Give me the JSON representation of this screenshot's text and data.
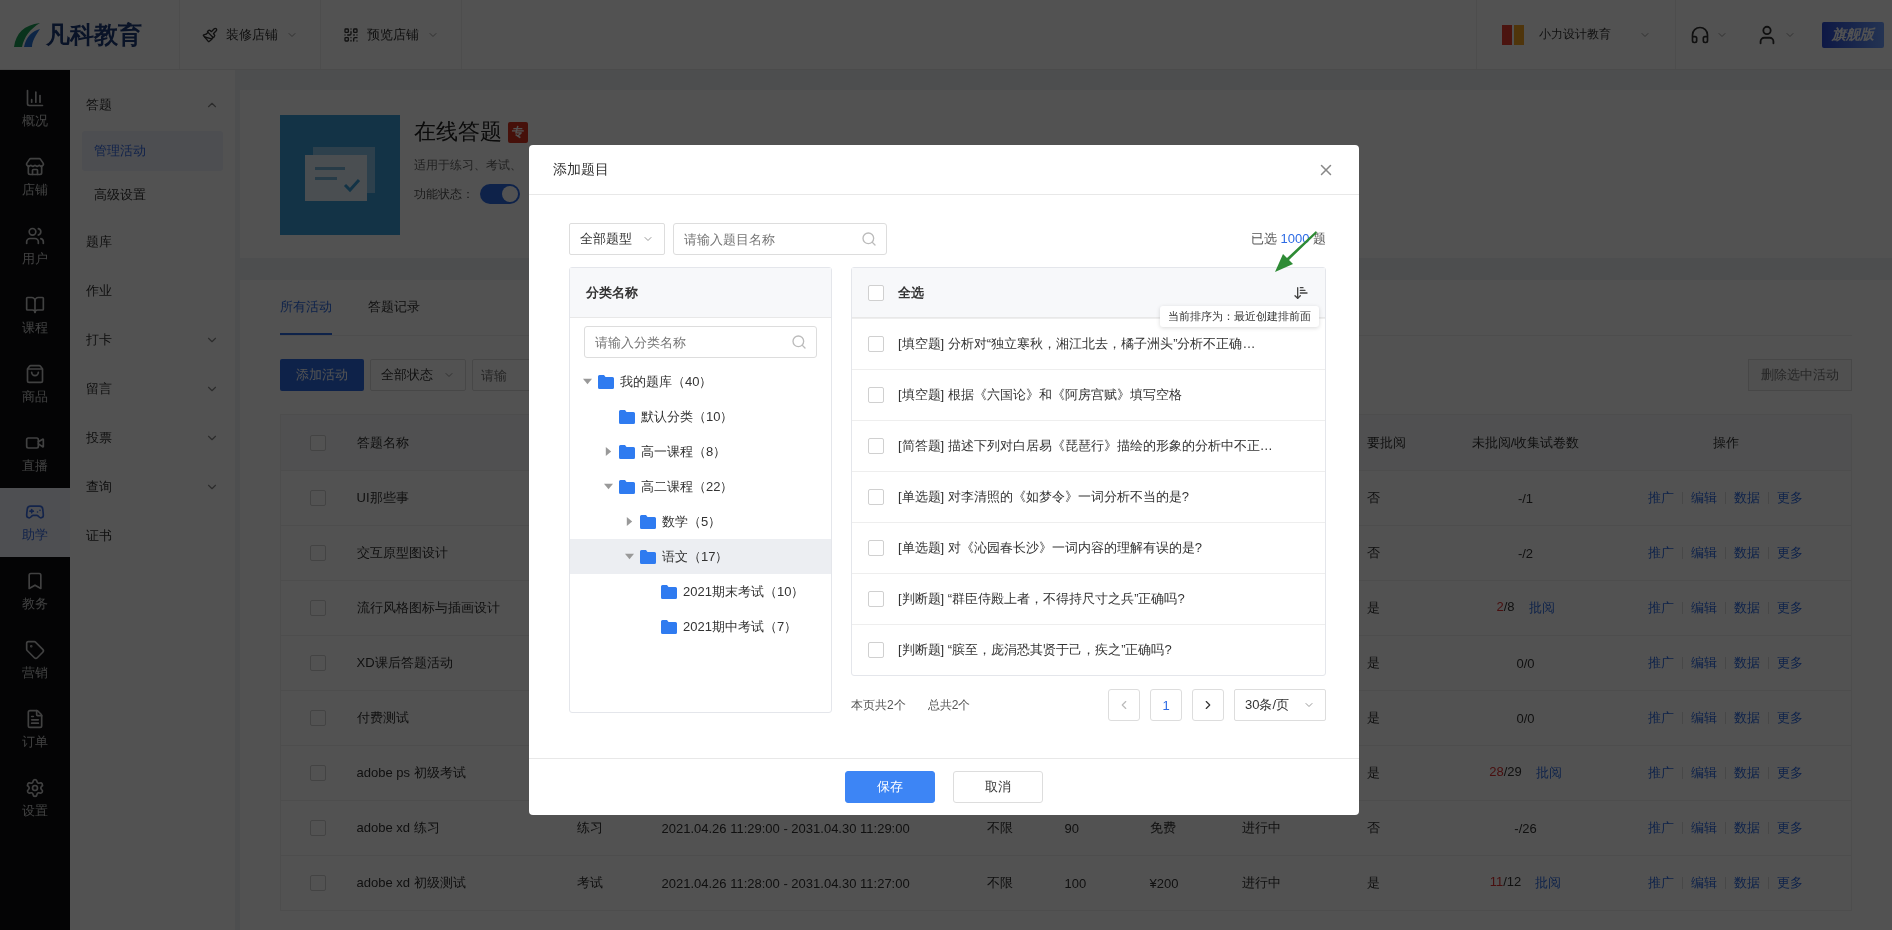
{
  "topbar": {
    "logo": "凡科教育",
    "menus": [
      {
        "label": "装修店铺"
      },
      {
        "label": "预览店铺"
      }
    ],
    "shop": "小力设计教育",
    "edition": "旗舰版"
  },
  "nav": [
    {
      "label": "概况",
      "selected": false
    },
    {
      "label": "店铺",
      "selected": false
    },
    {
      "label": "用户",
      "selected": false
    },
    {
      "label": "课程",
      "selected": false
    },
    {
      "label": "商品",
      "selected": false
    },
    {
      "label": "直播",
      "selected": false
    },
    {
      "label": "助学",
      "selected": true
    },
    {
      "label": "教务",
      "selected": false
    },
    {
      "label": "营销",
      "selected": false
    },
    {
      "label": "订单",
      "selected": false
    },
    {
      "label": "设置",
      "selected": false
    }
  ],
  "subnav": [
    {
      "label": "答题",
      "expanded": true,
      "children": [
        {
          "label": "管理活动",
          "selected": true
        },
        {
          "label": "高级设置",
          "selected": false
        }
      ]
    },
    {
      "label": "题库"
    },
    {
      "label": "作业"
    },
    {
      "label": "打卡",
      "expanded": false
    },
    {
      "label": "留言",
      "expanded": false
    },
    {
      "label": "投票",
      "expanded": false
    },
    {
      "label": "查询",
      "expanded": false
    },
    {
      "label": "证书"
    }
  ],
  "header": {
    "title": "在线答题",
    "tag": "专",
    "description": "适用于练习、考试、",
    "status_label": "功能状态：",
    "enabled": true
  },
  "tabs": [
    {
      "label": "所有活动",
      "selected": true
    },
    {
      "label": "答题记录",
      "selected": false
    }
  ],
  "toolbar": {
    "add_button": "添加活动",
    "status_filter": "全部状态",
    "search_placeholder": "请输",
    "delete_button": "删除选中活动",
    "delete_disabled": true
  },
  "table": {
    "all_checked": false,
    "columns": {
      "name": "答题名称",
      "review": "要批阅",
      "count": "未批阅/收集试卷数",
      "actions": "操作"
    },
    "rows": [
      {
        "checked": false,
        "name": "UI那些事",
        "review": "否",
        "pending": "-",
        "total": "/1",
        "alert": false,
        "actions": [
          "推广",
          "编辑",
          "数据",
          "更多"
        ]
      },
      {
        "checked": false,
        "name": "交互原型图设计",
        "review": "否",
        "pending": "-",
        "total": "/2",
        "alert": false,
        "actions": [
          "推广",
          "编辑",
          "数据",
          "更多"
        ]
      },
      {
        "checked": false,
        "name": "流行风格图标与插画设计",
        "review": "是",
        "pending": "2",
        "total": "/8",
        "alert": true,
        "link": "批阅",
        "actions": [
          "推广",
          "编辑",
          "数据",
          "更多"
        ]
      },
      {
        "checked": false,
        "name": "XD课后答题活动",
        "review": "是",
        "pending": "0",
        "total": "/0",
        "alert": false,
        "actions": [
          "推广",
          "编辑",
          "数据",
          "更多"
        ]
      },
      {
        "checked": false,
        "name": "付费测试",
        "review": "是",
        "pending": "0",
        "total": "/0",
        "alert": false,
        "actions": [
          "推广",
          "编辑",
          "数据",
          "更多"
        ]
      },
      {
        "checked": false,
        "name": "adobe ps 初级考试",
        "review": "是",
        "pending": "28",
        "total": "/29",
        "alert": true,
        "link": "批阅",
        "actions": [
          "推广",
          "编辑",
          "数据",
          "更多"
        ]
      },
      {
        "checked": false,
        "name": "adobe xd 练习",
        "type": "练习",
        "period": "2021.04.26 11:29:00 - 2031.04.30 11:29:00",
        "limit": "不限",
        "quota": "90",
        "fee": "免费",
        "status": "进行中",
        "review": "否",
        "pending": "-",
        "total": "/26",
        "alert": false,
        "actions": [
          "推广",
          "编辑",
          "数据",
          "更多"
        ]
      },
      {
        "checked": false,
        "name": "adobe xd 初级测试",
        "type": "考试",
        "period": "2021.04.26 11:28:00 - 2031.04.30 11:27:00",
        "limit": "不限",
        "quota": "100",
        "fee": "¥200",
        "status": "进行中",
        "review": "是",
        "pending": "11",
        "total": "/12",
        "alert": true,
        "link": "批阅",
        "actions": [
          "推广",
          "编辑",
          "数据",
          "更多"
        ]
      }
    ]
  },
  "modal": {
    "title": "添加题目",
    "type_filter": "全部题型",
    "search_placeholder": "请输入题目名称",
    "selected_prefix": "已选",
    "selected_count": "1000",
    "selected_suffix": "题",
    "category": {
      "header": "分类名称",
      "search_placeholder": "请输入分类名称",
      "tree": [
        {
          "label": "我的题库（40）",
          "expanded": true,
          "selected": false,
          "children": [
            {
              "label": "默认分类（10）",
              "selected": false
            },
            {
              "label": "高一课程（8）",
              "expanded": false,
              "selected": false
            },
            {
              "label": "高二课程（22）",
              "expanded": true,
              "selected": false,
              "children": [
                {
                  "label": "数学（5）",
                  "expanded": false,
                  "selected": false
                },
                {
                  "label": "语文（17）",
                  "expanded": true,
                  "selected": true,
                  "children": [
                    {
                      "label": "2021期末考试（10）",
                      "selected": false
                    },
                    {
                      "label": "2021期中考试（7）",
                      "selected": false
                    }
                  ]
                }
              ]
            }
          ]
        }
      ]
    },
    "questions": {
      "select_all": "全选",
      "all_checked": false,
      "sort_tooltip": "当前排序为：最近创建排前面",
      "items": [
        {
          "text": "[填空题] 分析对“独立寒秋，湘江北去，橘子洲头”分析不正确…",
          "checked": false
        },
        {
          "text": "[填空题] 根据《六国论》和《阿房宫赋》填写空格",
          "checked": false
        },
        {
          "text": "[简答题] 描述下列对白居易《琵琶行》描绘的形象的分析中不正…",
          "checked": false
        },
        {
          "text": "[单选题] 对李清照的《如梦令》一词分析不当的是?",
          "checked": false
        },
        {
          "text": "[单选题] 对《沁园春长沙》一词内容的理解有误的是?",
          "checked": false
        },
        {
          "text": "[判断题] “群臣侍殿上者，不得持尺寸之兵”正确吗?",
          "checked": false
        },
        {
          "text": "[判断题] “膑至，庞涓恐其贤于己，疾之”正确吗?",
          "checked": false
        }
      ]
    },
    "pagination": {
      "page_count": "本页共2个",
      "total": "总共2个",
      "pages": [
        {
          "label": "1",
          "selected": true
        }
      ],
      "page_size": "30条/页"
    },
    "buttons": [
      {
        "label": "保存",
        "kind": "primary"
      },
      {
        "label": "取消",
        "kind": "default"
      }
    ]
  }
}
